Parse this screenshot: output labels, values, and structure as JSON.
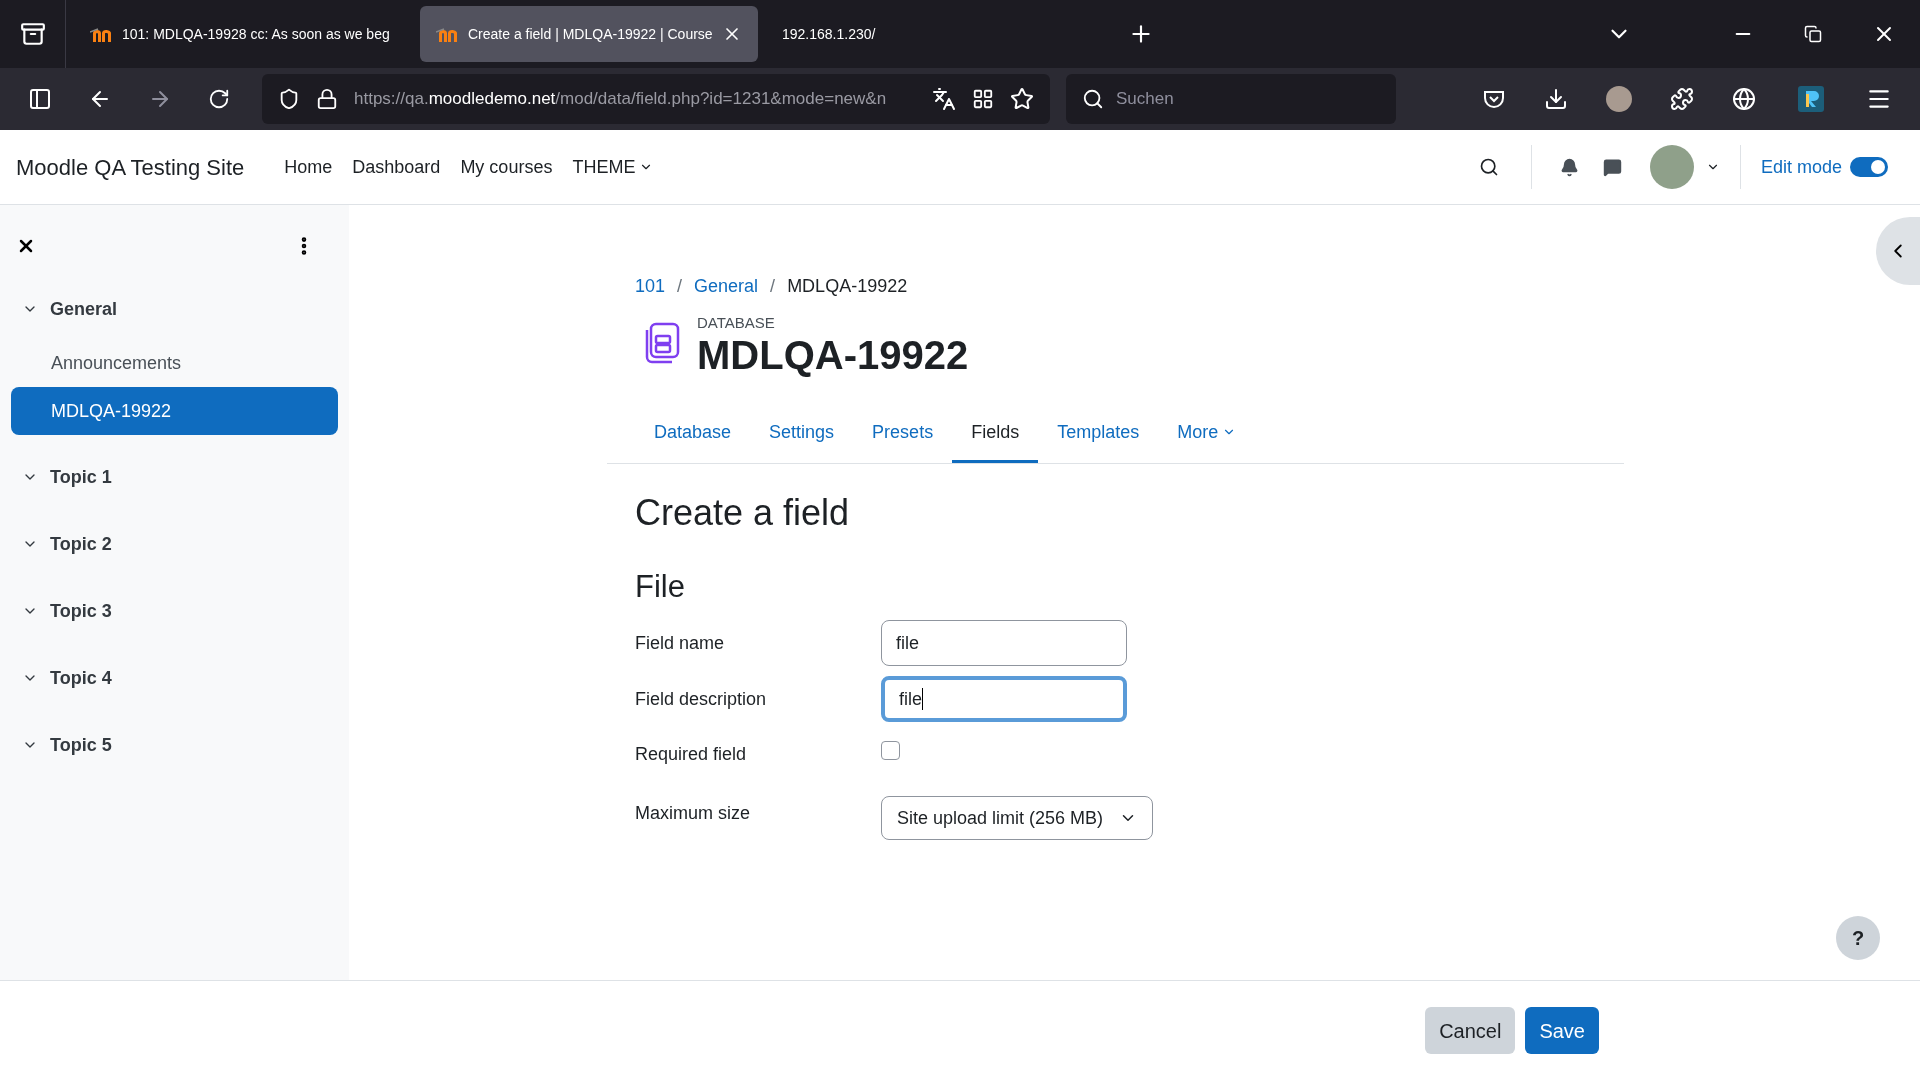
{
  "browser": {
    "tabs": [
      {
        "title": "101: MDLQA-19928 cc: As soon as we beg",
        "selected": false,
        "favicon": true
      },
      {
        "title": "Create a field | MDLQA-19922 | Course",
        "selected": true,
        "favicon": true
      },
      {
        "title": "192.168.1.230/",
        "selected": false,
        "favicon": false
      }
    ],
    "url_parts": [
      {
        "text": "https://qa.",
        "emphasis": false
      },
      {
        "text": "moodledemo.net",
        "emphasis": true
      },
      {
        "text": "/mod/data/field.php?id=1231&mode=new&n",
        "emphasis": false
      }
    ],
    "search": {
      "placeholder": "Suchen"
    }
  },
  "site": {
    "name": "Moodle QA Testing Site",
    "nav": [
      {
        "label": "Home",
        "kind": "link"
      },
      {
        "label": "Dashboard",
        "kind": "link"
      },
      {
        "label": "My courses",
        "kind": "link"
      },
      {
        "label": "THEME",
        "kind": "menu"
      }
    ],
    "edit_mode": {
      "label": "Edit mode",
      "on": true
    }
  },
  "sidebar": {
    "items": [
      {
        "label": "General",
        "expanded": true,
        "children": [
          {
            "label": "Announcements",
            "selected": false
          },
          {
            "label": "MDLQA-19922",
            "selected": true
          }
        ]
      },
      {
        "label": "Topic 1",
        "expanded": true
      },
      {
        "label": "Topic 2",
        "expanded": true
      },
      {
        "label": "Topic 3",
        "expanded": true
      },
      {
        "label": "Topic 4",
        "expanded": true
      },
      {
        "label": "Topic 5",
        "expanded": true
      }
    ]
  },
  "breadcrumb": {
    "separator": "/",
    "items": [
      "101",
      "General",
      "MDLQA-19922"
    ]
  },
  "activity": {
    "type_label": "DATABASE",
    "title": "MDLQA-19922"
  },
  "tabs": [
    {
      "label": "Database",
      "selected": false,
      "menu": false
    },
    {
      "label": "Settings",
      "selected": false,
      "menu": false
    },
    {
      "label": "Presets",
      "selected": false,
      "menu": false
    },
    {
      "label": "Fields",
      "selected": true,
      "menu": false
    },
    {
      "label": "Templates",
      "selected": false,
      "menu": false
    },
    {
      "label": "More",
      "selected": false,
      "menu": true
    }
  ],
  "form": {
    "heading": "Create a field",
    "section": "File",
    "fields": [
      {
        "kind": "text",
        "label": "Field name",
        "value": "file",
        "focused": false
      },
      {
        "kind": "text",
        "label": "Field description",
        "value": "file",
        "focused": true
      },
      {
        "kind": "checkbox",
        "label": "Required field",
        "checked": false
      },
      {
        "kind": "select",
        "label": "Maximum size",
        "value": "Site upload limit (256 MB)"
      }
    ]
  },
  "help": "?",
  "buttons": [
    {
      "label": "Cancel",
      "kind": "secondary"
    },
    {
      "label": "Save",
      "kind": "primary"
    }
  ]
}
